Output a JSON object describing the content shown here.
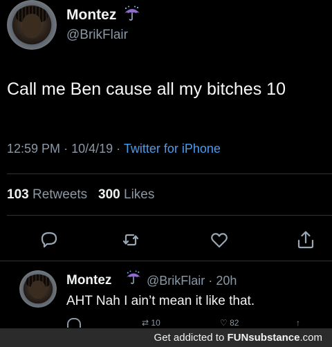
{
  "tweet": {
    "author_name": "Montez",
    "author_handle": "@BrikFlair",
    "author_badge_icon": "umbrella-rain-emoji",
    "text": "Call me Ben cause all my bitches 10",
    "time": "12:59 PM",
    "sep1": "·",
    "date": "10/4/19",
    "sep2": "·",
    "source": "Twitter for iPhone",
    "retweet_count": "103",
    "retweets_label": "Retweets",
    "like_count": "300",
    "likes_label": "Likes"
  },
  "reply": {
    "author_name": "Montez",
    "author_badge_icon": "umbrella-rain-emoji",
    "author_handle": "@BrikFlair",
    "sep": "·",
    "age": "20h",
    "text": "AHT Nah I ain’t mean it like that.",
    "retweet_count": "10",
    "like_count": "82"
  },
  "footer": {
    "prefix": "Get addicted to ",
    "brand": "FUNsubstance",
    "suffix": ".com"
  },
  "colors": {
    "background": "#000000",
    "link": "#4a9ded",
    "muted": "#8b98a5",
    "umbrella": "#8e6bd0"
  }
}
